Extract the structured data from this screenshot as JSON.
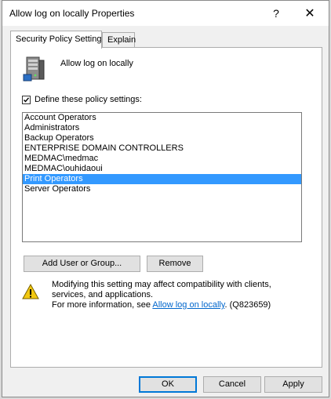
{
  "window": {
    "title": "Allow log on locally Properties",
    "help_glyph": "?",
    "close_glyph": "✕"
  },
  "tabs": [
    {
      "label": "Security Policy Setting",
      "active": true
    },
    {
      "label": "Explain",
      "active": false
    }
  ],
  "policy": {
    "icon": "server-icon",
    "name": "Allow log on locally"
  },
  "define_checkbox": {
    "label": "Define these policy settings:",
    "checked": true
  },
  "list": {
    "items": [
      "Account Operators",
      "Administrators",
      "Backup Operators",
      "ENTERPRISE DOMAIN CONTROLLERS",
      "MEDMAC\\medmac",
      "MEDMAC\\ouhidaoui",
      "Print Operators",
      "Server Operators"
    ],
    "selected_index": 6
  },
  "buttons": {
    "add_label": "Add User or Group...",
    "remove_label": "Remove"
  },
  "warning": {
    "icon": "warning-icon",
    "line1": "Modifying this setting may affect compatibility with clients, services, and applications.",
    "more_prefix": "For more information, see ",
    "link": "Allow log on locally",
    "more_suffix": ". (Q823659)"
  },
  "footer": {
    "ok": "OK",
    "cancel": "Cancel",
    "apply": "Apply"
  },
  "colors": {
    "selection": "#3399ff",
    "link": "#0066cc",
    "default_button_border": "#0078d7"
  }
}
